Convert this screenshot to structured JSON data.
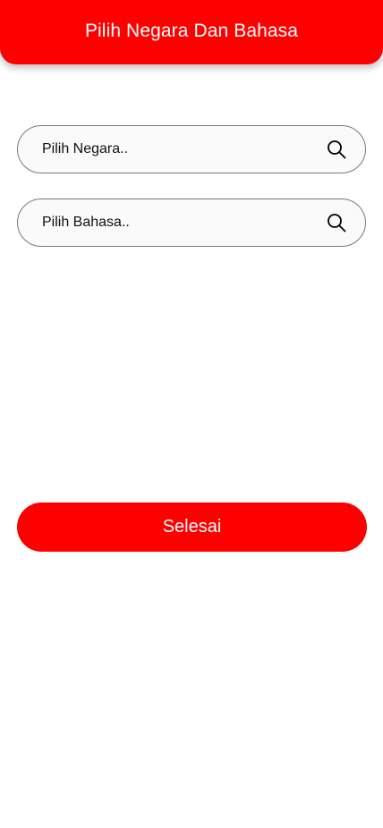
{
  "header": {
    "title": "Pilih Negara Dan Bahasa"
  },
  "form": {
    "country_field": {
      "placeholder": "Pilih Negara..",
      "value": "",
      "icon": "search-icon"
    },
    "language_field": {
      "placeholder": "Pilih Bahasa..",
      "value": "",
      "icon": "search-icon"
    },
    "submit_label": "Selesai"
  },
  "colors": {
    "accent": "#ff0000",
    "field_border": "#7a7a7a",
    "field_background": "#fafafa",
    "page_background": "#ffffff"
  }
}
